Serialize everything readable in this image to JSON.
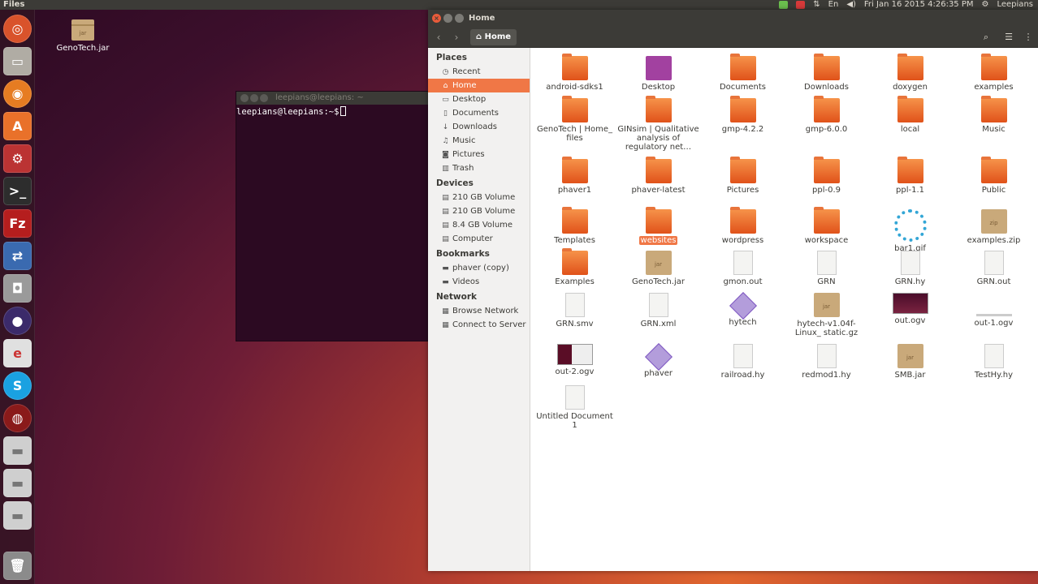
{
  "top_panel": {
    "app_name": "Files",
    "keyboard": "En",
    "datetime": "Fri Jan 16 2015  4:26:35 PM",
    "user": "Leepians"
  },
  "launcher": {
    "items": [
      "ubuntu-dash",
      "files",
      "firefox",
      "software-center",
      "settings",
      "terminal",
      "filezilla",
      "remote-desktop",
      "cheese",
      "eclipse",
      "libreoffice",
      "skype",
      "recorder",
      "drive",
      "drive",
      "drive",
      "trash"
    ]
  },
  "desktop": {
    "icons": [
      {
        "label": "GenoTech.jar",
        "type": "jar"
      }
    ]
  },
  "terminal": {
    "title": "leepians@leepians: ~",
    "prompt": "leepians@leepians:~$"
  },
  "file_manager": {
    "title": "Home",
    "path": "Home",
    "sidebar": {
      "places_title": "Places",
      "places": [
        "Recent",
        "Home",
        "Desktop",
        "Documents",
        "Downloads",
        "Music",
        "Pictures",
        "Trash"
      ],
      "devices_title": "Devices",
      "devices": [
        "210 GB Volume",
        "210 GB Volume",
        "8.4 GB Volume",
        "Computer"
      ],
      "bookmarks_title": "Bookmarks",
      "bookmarks": [
        "phaver (copy)",
        "Videos"
      ],
      "network_title": "Network",
      "network": [
        "Browse Network",
        "Connect to Server"
      ]
    },
    "files": [
      {
        "name": "android-sdks1",
        "kind": "folder"
      },
      {
        "name": "Desktop",
        "kind": "desktop"
      },
      {
        "name": "Documents",
        "kind": "folder"
      },
      {
        "name": "Downloads",
        "kind": "folder"
      },
      {
        "name": "doxygen",
        "kind": "folder"
      },
      {
        "name": "examples",
        "kind": "folder"
      },
      {
        "name": "GenoTech | Home_ files",
        "kind": "folder"
      },
      {
        "name": "GINsim | Qualitative analysis of regulatory net…",
        "kind": "folder"
      },
      {
        "name": "gmp-4.2.2",
        "kind": "folder"
      },
      {
        "name": "gmp-6.0.0",
        "kind": "folder"
      },
      {
        "name": "local",
        "kind": "folder"
      },
      {
        "name": "Music",
        "kind": "folder"
      },
      {
        "name": "phaver1",
        "kind": "folder"
      },
      {
        "name": "phaver-latest",
        "kind": "folder"
      },
      {
        "name": "Pictures",
        "kind": "folder"
      },
      {
        "name": "ppl-0.9",
        "kind": "folder"
      },
      {
        "name": "ppl-1.1",
        "kind": "folder"
      },
      {
        "name": "Public",
        "kind": "folder"
      },
      {
        "name": "Templates",
        "kind": "folder"
      },
      {
        "name": "websites",
        "kind": "folder-selected"
      },
      {
        "name": "wordpress",
        "kind": "folder"
      },
      {
        "name": "workspace",
        "kind": "folder"
      },
      {
        "name": "bar1.gif",
        "kind": "spinner"
      },
      {
        "name": "examples.zip",
        "kind": "zip"
      },
      {
        "name": "Examples",
        "kind": "folder"
      },
      {
        "name": "GenoTech.jar",
        "kind": "jar"
      },
      {
        "name": "gmon.out",
        "kind": "doc"
      },
      {
        "name": "GRN",
        "kind": "doc"
      },
      {
        "name": "GRN.hy",
        "kind": "doc"
      },
      {
        "name": "GRN.out",
        "kind": "doc"
      },
      {
        "name": "GRN.smv",
        "kind": "doc"
      },
      {
        "name": "GRN.xml",
        "kind": "doc"
      },
      {
        "name": "hytech",
        "kind": "diamond"
      },
      {
        "name": "hytech-v1.04f-Linux_ static.gz",
        "kind": "jar"
      },
      {
        "name": "out.ogv",
        "kind": "img-dark"
      },
      {
        "name": "out-1.ogv",
        "kind": "line-thin"
      },
      {
        "name": "out-2.ogv",
        "kind": "img-split"
      },
      {
        "name": "phaver",
        "kind": "diamond"
      },
      {
        "name": "railroad.hy",
        "kind": "doc"
      },
      {
        "name": "redmod1.hy",
        "kind": "doc"
      },
      {
        "name": "SMB.jar",
        "kind": "jar"
      },
      {
        "name": "TestHy.hy",
        "kind": "doc"
      },
      {
        "name": "Untitled Document 1",
        "kind": "doc"
      }
    ]
  }
}
